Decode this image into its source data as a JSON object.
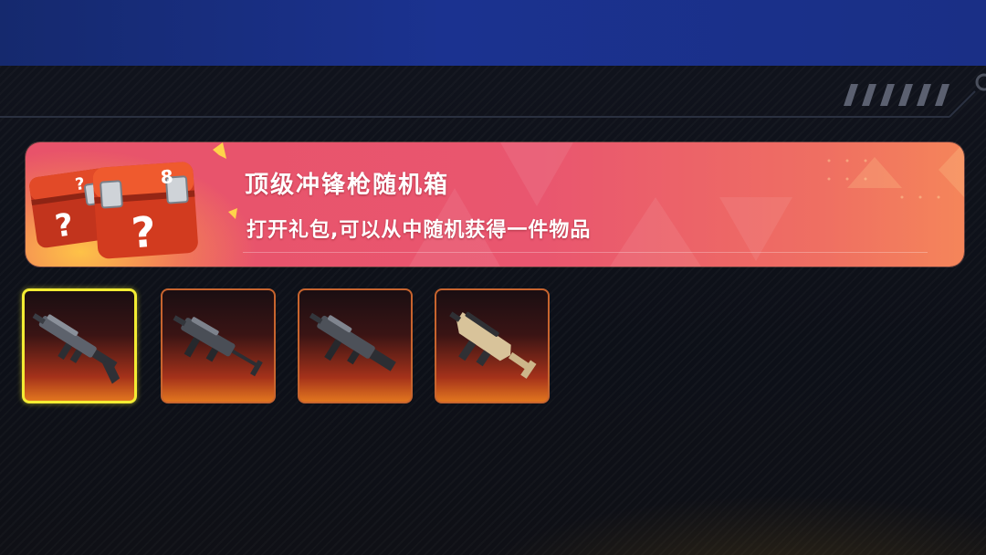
{
  "banner": {
    "title": "顶级冲锋枪随机箱",
    "description": "打开礼包,可以从中随机获得一件物品"
  },
  "items": [
    {
      "name": "smg-1",
      "icon": "rifle-icon",
      "selected": true
    },
    {
      "name": "smg-2",
      "icon": "smg-icon",
      "selected": false
    },
    {
      "name": "smg-3",
      "icon": "smg-icon",
      "selected": false
    },
    {
      "name": "smg-4",
      "icon": "tan-smg-icon",
      "selected": false
    }
  ],
  "colors": {
    "top_band": "#1b3290",
    "banner_pink": "#e8536a",
    "banner_orange": "#f5855a",
    "selected_border": "#f3ec33",
    "slot_border": "#c8642e"
  }
}
